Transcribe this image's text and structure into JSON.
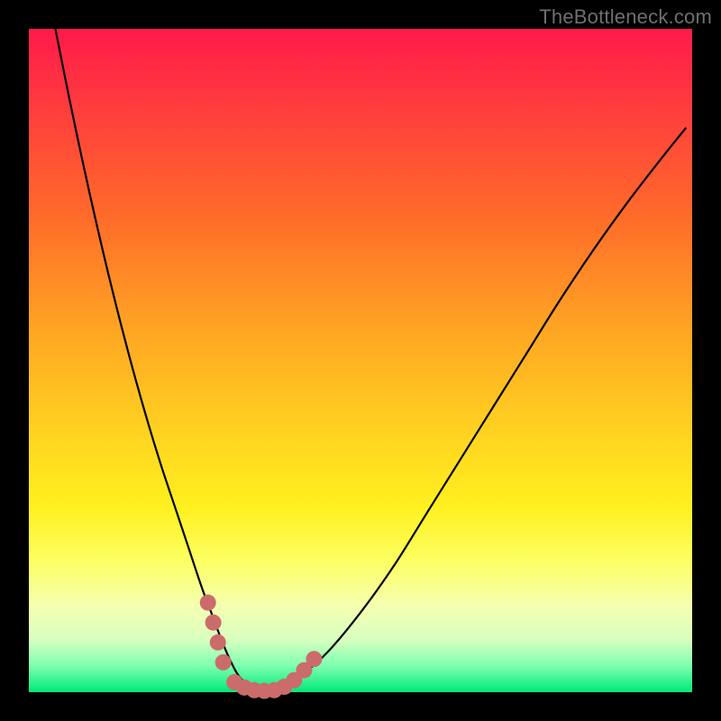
{
  "watermark": {
    "text": "TheBottleneck.com"
  },
  "chart_data": {
    "type": "line",
    "title": "",
    "xlabel": "",
    "ylabel": "",
    "xlim": [
      0,
      100
    ],
    "ylim": [
      0,
      100
    ],
    "grid": false,
    "legend": false,
    "series": [
      {
        "name": "curve",
        "x": [
          4,
          6,
          8,
          10,
          12,
          14,
          16,
          18,
          20,
          22,
          24,
          26,
          27.5,
          29,
          30.5,
          32,
          34,
          36,
          38,
          41,
          45,
          50,
          55,
          60,
          65,
          70,
          75,
          80,
          85,
          90,
          95,
          99
        ],
        "values": [
          100,
          90,
          80.5,
          71.5,
          63,
          55,
          47.5,
          40.5,
          34,
          28,
          22,
          16,
          12,
          8,
          4.5,
          2,
          0.5,
          0,
          0.5,
          2.5,
          6,
          12,
          19,
          27,
          35,
          43,
          51,
          59,
          66.5,
          73.5,
          80,
          85
        ]
      }
    ],
    "markers": {
      "comment": "pink rounded dots near the minimum",
      "color": "#cc6b6b",
      "points": [
        {
          "x": 27.0,
          "y": 13.5
        },
        {
          "x": 27.8,
          "y": 10.5
        },
        {
          "x": 28.5,
          "y": 7.5
        },
        {
          "x": 29.3,
          "y": 4.5
        },
        {
          "x": 31.0,
          "y": 1.5
        },
        {
          "x": 32.5,
          "y": 0.7
        },
        {
          "x": 34.0,
          "y": 0.3
        },
        {
          "x": 35.5,
          "y": 0.2
        },
        {
          "x": 37.0,
          "y": 0.3
        },
        {
          "x": 38.5,
          "y": 0.8
        },
        {
          "x": 40.0,
          "y": 1.8
        },
        {
          "x": 41.5,
          "y": 3.3
        },
        {
          "x": 43.0,
          "y": 5.0
        }
      ]
    }
  }
}
